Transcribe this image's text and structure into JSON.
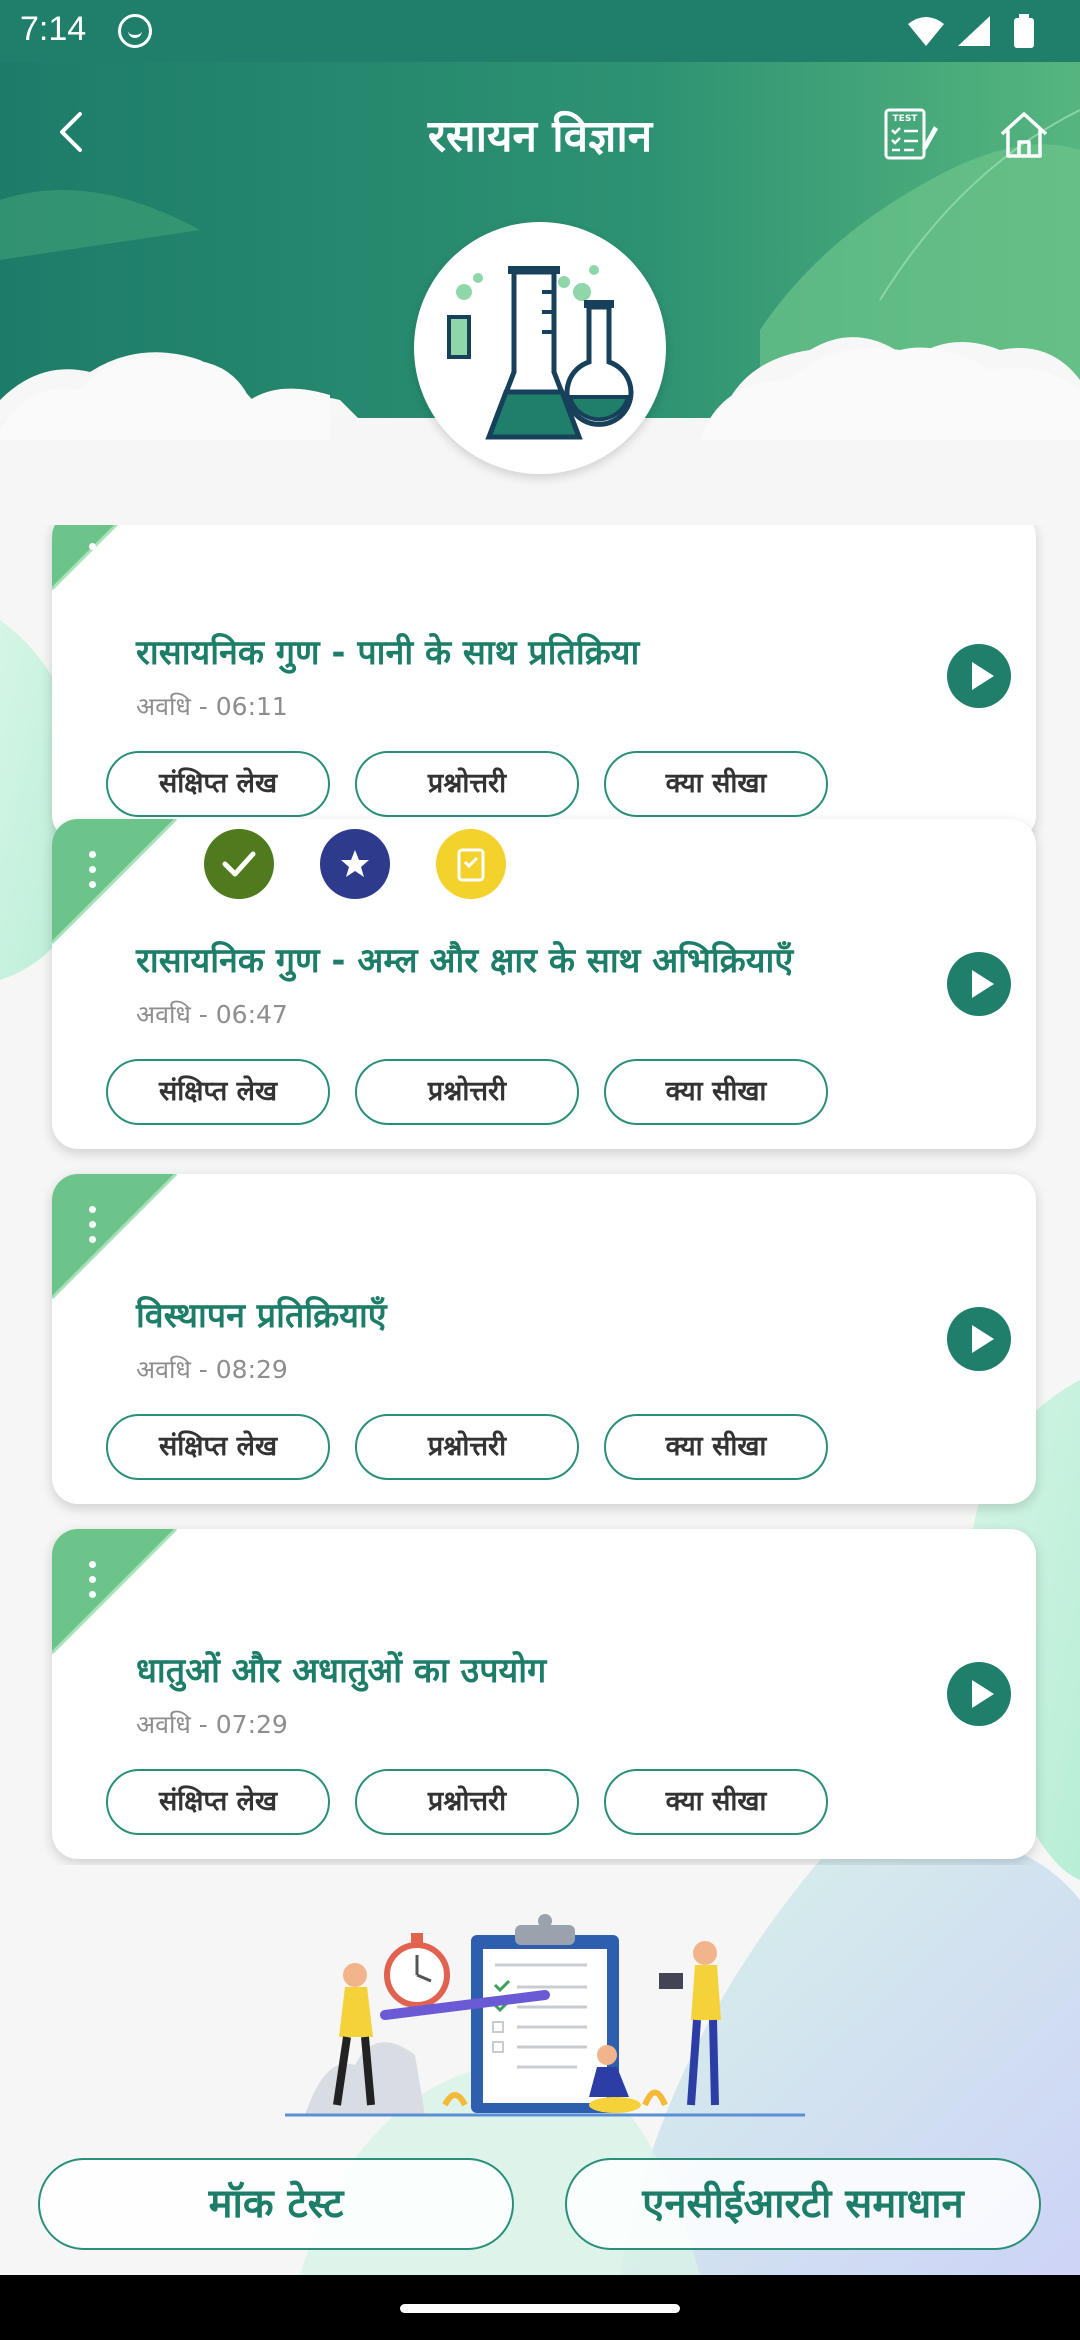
{
  "status_bar": {
    "time": "7:14"
  },
  "header": {
    "title": "रसायन विज्ञान",
    "test_icon_label": "TEST"
  },
  "topics": [
    {
      "title": "रासायनिक गुण - पानी के साथ प्रतिक्रिया",
      "duration": "अवधि - 06:11",
      "badges": [],
      "chips": [
        "संक्षिप्त लेख",
        "प्रश्नोत्तरी",
        "क्या सीखा"
      ]
    },
    {
      "title": "रासायनिक गुण - अम्ल और क्षार के साथ अभिक्रियाएँ",
      "duration": "अवधि - 06:47",
      "badges": [
        "check-icon",
        "star-icon",
        "notes-icon"
      ],
      "chips": [
        "संक्षिप्त लेख",
        "प्रश्नोत्तरी",
        "क्या सीखा"
      ]
    },
    {
      "title": "विस्थापन प्रतिक्रियाएँ",
      "duration": "अवधि - 08:29",
      "badges": [],
      "chips": [
        "संक्षिप्त लेख",
        "प्रश्नोत्तरी",
        "क्या सीखा"
      ]
    },
    {
      "title": "धातुओं और अधातुओं का उपयोग",
      "duration": "अवधि - 07:29",
      "badges": [],
      "chips": [
        "संक्षिप्त लेख",
        "प्रश्नोत्तरी",
        "क्या सीखा"
      ]
    }
  ],
  "bottom_buttons": {
    "mock_test": "मॉक टेस्ट",
    "ncert_solutions": "एनसीईआरटी समाधान"
  },
  "colors": {
    "primary": "#1f7f6b",
    "title_green": "#1c7d68",
    "check": "#4f7a1e",
    "star": "#2e3b8c",
    "note": "#f3d22c"
  }
}
